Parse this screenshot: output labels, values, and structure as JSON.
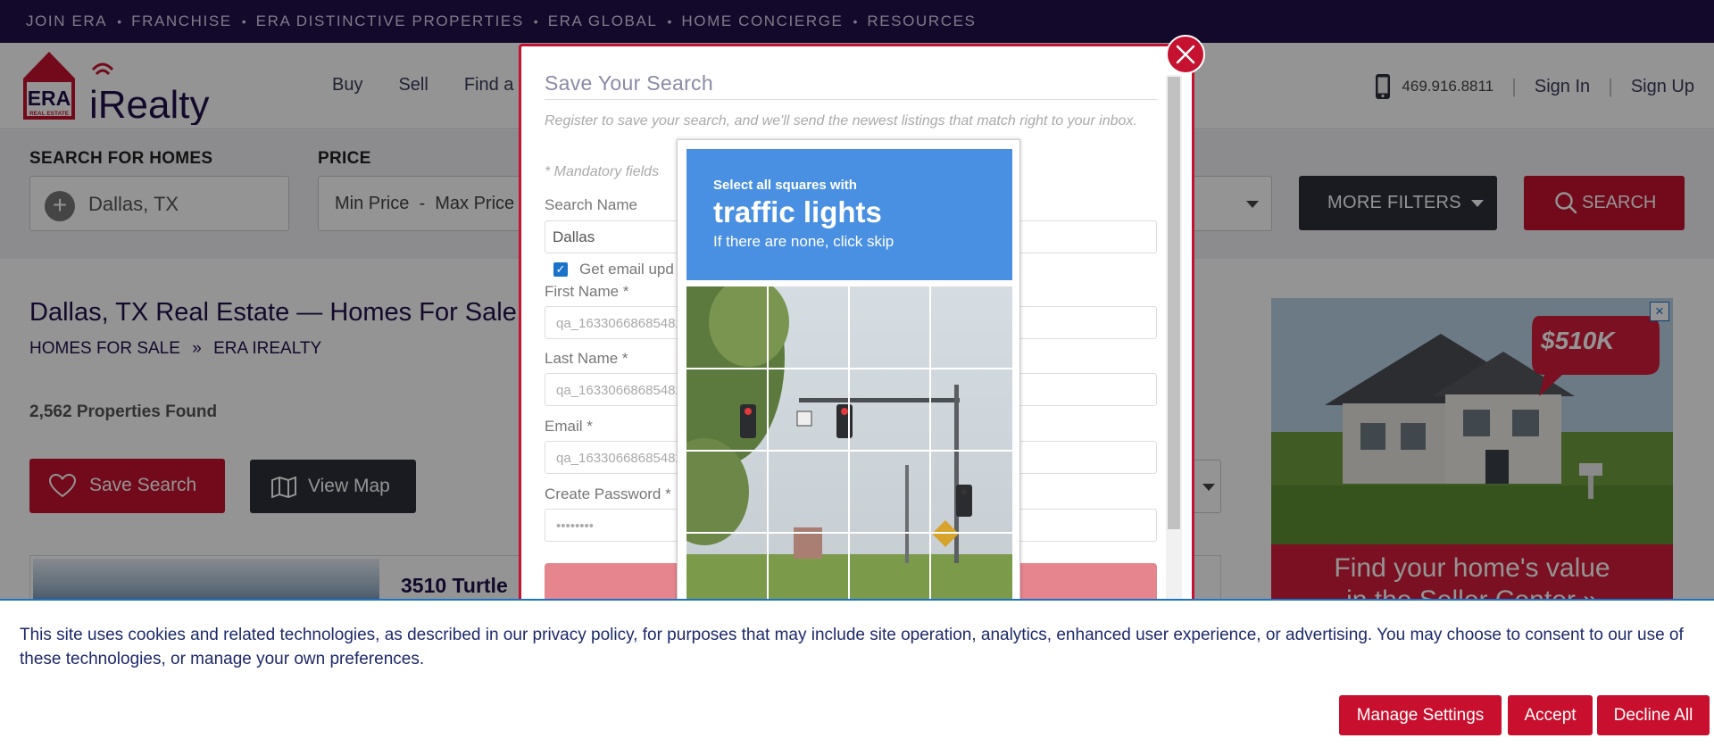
{
  "topbar": {
    "links": [
      "JOIN ERA",
      "FRANCHISE",
      "ERA DISTINCTIVE PROPERTIES",
      "ERA GLOBAL",
      "HOME CONCIERGE",
      "RESOURCES"
    ],
    "separator": "•"
  },
  "header": {
    "logo": {
      "brand": "ERA",
      "tagline": "REAL ESTATE",
      "name": "iRealty"
    },
    "nav": [
      "Buy",
      "Sell",
      "Find a"
    ],
    "phone": "469.916.8811",
    "sign_in": "Sign In",
    "sign_up": "Sign Up"
  },
  "search": {
    "location_label": "SEARCH FOR HOMES",
    "location_value": "Dallas, TX",
    "price_label": "PRICE",
    "price_value": "Min Price  -  Max Price",
    "more_filters": "MORE FILTERS",
    "search_button": "SEARCH"
  },
  "main": {
    "title": "Dallas, TX Real Estate — Homes For Sale",
    "breadcrumb": [
      "HOMES FOR SALE",
      "ERA IREALTY"
    ],
    "breadcrumb_sep": "»",
    "count": "2,562 Properties Found",
    "save_search": "Save Search",
    "view_map": "View Map",
    "listing_address": "3510 Turtle"
  },
  "ad": {
    "price": "$510K",
    "line1": "Find your home's value",
    "line2": "in the Seller Center »"
  },
  "modal": {
    "title": "Save Your Search",
    "intro": "Register to save your search, and we'll send the newest listings that match right to your inbox.",
    "mandatory": "* Mandatory fields",
    "search_name_label": "Search Name",
    "search_name_value": "Dallas",
    "email_updates_label": "Get email upd",
    "email_updates_checked": true,
    "first_name_label": "First Name *",
    "first_name_value": "qa_16330668685482",
    "last_name_label": "Last Name *",
    "last_name_value": "qa_16330668685482",
    "email_label": "Email *",
    "email_value": "qa_16330668685482",
    "password_label": "Create Password *",
    "password_value": "••••••••"
  },
  "captcha": {
    "line1": "Select all squares with",
    "line2": "traffic lights",
    "line3": "If there are none, click skip"
  },
  "cookie": {
    "text": "This site uses cookies and related technologies, as described in our privacy policy, for purposes that may include site operation, analytics, enhanced user experience, or advertising. You may choose to consent to our use of these technologies, or manage your own preferences.",
    "manage": "Manage Settings",
    "accept": "Accept",
    "decline": "Decline All"
  },
  "colors": {
    "topbar": "#22114a",
    "brand_red": "#c41230",
    "dark_button": "#2c2f3a",
    "captcha_blue": "#4a90e2"
  }
}
